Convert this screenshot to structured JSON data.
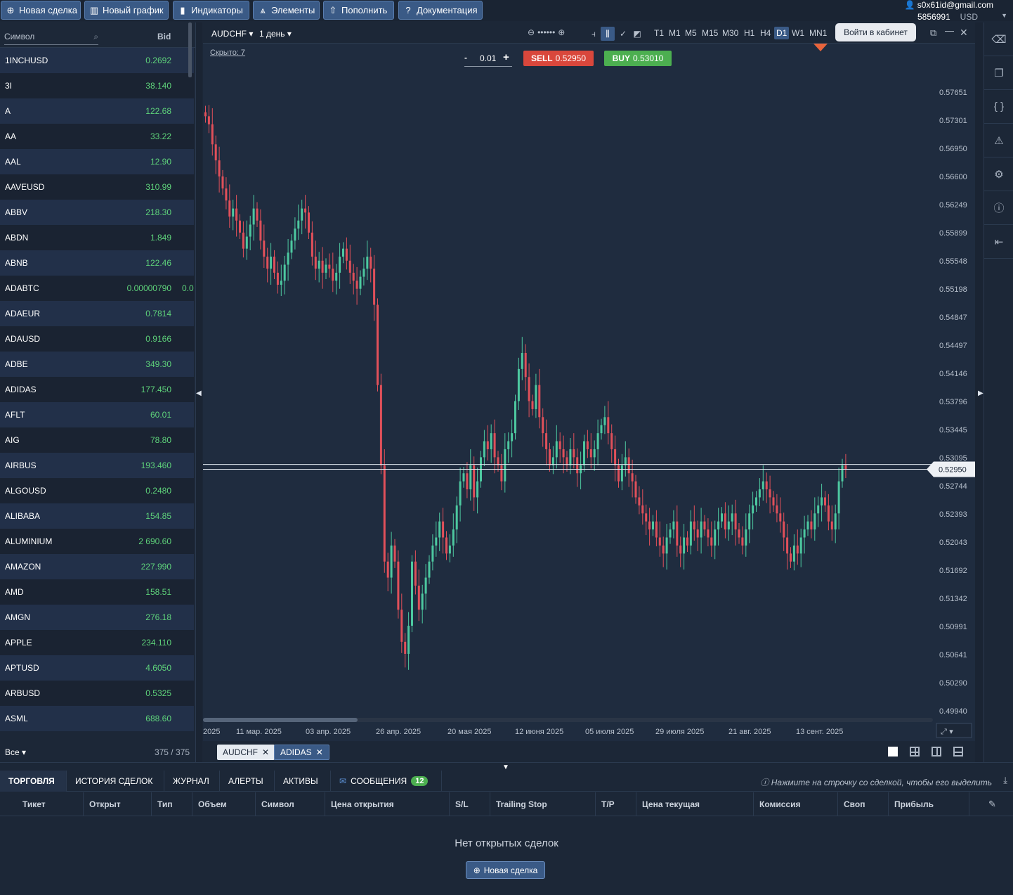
{
  "topbar": {
    "buttons": [
      "Новая сделка",
      "Новый график",
      "Индикаторы",
      "Элементы",
      "Пополнить",
      "Документация"
    ],
    "account_email": "s0x61id@gmail.com",
    "account_number": "5856991",
    "account_currency": "USD"
  },
  "symbols": {
    "search_placeholder": "Символ",
    "bid_header": "Bid",
    "items": [
      {
        "name": "1INCHUSD",
        "bid": "0.2692"
      },
      {
        "name": "3I",
        "bid": "38.140"
      },
      {
        "name": "A",
        "bid": "122.68"
      },
      {
        "name": "AA",
        "bid": "33.22"
      },
      {
        "name": "AAL",
        "bid": "12.90"
      },
      {
        "name": "AAVEUSD",
        "bid": "310.99"
      },
      {
        "name": "ABBV",
        "bid": "218.30"
      },
      {
        "name": "ABDN",
        "bid": "1.849"
      },
      {
        "name": "ABNB",
        "bid": "122.46"
      },
      {
        "name": "ADABTC",
        "bid": "0.00000790",
        "bid_extra": "0.0"
      },
      {
        "name": "ADAEUR",
        "bid": "0.7814"
      },
      {
        "name": "ADAUSD",
        "bid": "0.9166"
      },
      {
        "name": "ADBE",
        "bid": "349.30"
      },
      {
        "name": "ADIDAS",
        "bid": "177.450"
      },
      {
        "name": "AFLT",
        "bid": "60.01"
      },
      {
        "name": "AIG",
        "bid": "78.80"
      },
      {
        "name": "AIRBUS",
        "bid": "193.460"
      },
      {
        "name": "ALGOUSD",
        "bid": "0.2480"
      },
      {
        "name": "ALIBABA",
        "bid": "154.85"
      },
      {
        "name": "ALUMINIUM",
        "bid": "2 690.60"
      },
      {
        "name": "AMAZON",
        "bid": "227.990"
      },
      {
        "name": "AMD",
        "bid": "158.51"
      },
      {
        "name": "AMGN",
        "bid": "276.18"
      },
      {
        "name": "APPLE",
        "bid": "234.110"
      },
      {
        "name": "APTUSD",
        "bid": "4.6050"
      },
      {
        "name": "ARBUSD",
        "bid": "0.5325"
      },
      {
        "name": "ASML",
        "bid": "688.60"
      }
    ],
    "filter": "Все",
    "count": "375 / 375"
  },
  "chart_header": {
    "symbol": "AUDCHF",
    "period": "1 день",
    "timeframes": [
      "T1",
      "M1",
      "M5",
      "M15",
      "M30",
      "H1",
      "H4",
      "D1",
      "W1",
      "MN1"
    ],
    "active_timeframe": "D1",
    "login_tooltip": "Войти в кабинет"
  },
  "trade": {
    "hidden": "Скрыто: 7",
    "lot": "0.01",
    "minus": "-",
    "plus": "+",
    "sell_label": "SELL",
    "sell_price": "0.52950",
    "buy_label": "BUY",
    "buy_price": "0.53010"
  },
  "chart_data": {
    "type": "candlestick",
    "symbol": "AUDCHF",
    "y_ticks": [
      "0.57651",
      "0.57301",
      "0.56950",
      "0.56600",
      "0.56249",
      "0.55899",
      "0.55548",
      "0.55198",
      "0.54847",
      "0.54497",
      "0.54146",
      "0.53796",
      "0.53445",
      "0.53095",
      "0.52744",
      "0.52393",
      "0.52043",
      "0.51692",
      "0.51342",
      "0.50991",
      "0.50641",
      "0.50290",
      "0.49940"
    ],
    "ylim": [
      0.4994,
      0.57651
    ],
    "x_ticks": [
      "2025",
      "11 мар. 2025",
      "03 апр. 2025",
      "26 апр. 2025",
      "20 мая 2025",
      "12 июня 2025",
      "05 июля 2025",
      "29 июля 2025",
      "21 авг. 2025",
      "13 сент. 2025"
    ],
    "current_price": "0.52950",
    "upper_price_label": "0.53010",
    "close_series_approx": [
      0.5735,
      0.5725,
      0.57,
      0.568,
      0.566,
      0.5645,
      0.563,
      0.561,
      0.562,
      0.5605,
      0.559,
      0.557,
      0.5585,
      0.56,
      0.562,
      0.5605,
      0.558,
      0.556,
      0.5545,
      0.556,
      0.554,
      0.5525,
      0.553,
      0.555,
      0.5565,
      0.558,
      0.5595,
      0.5605,
      0.562,
      0.5615,
      0.559,
      0.556,
      0.5545,
      0.5555,
      0.554,
      0.555,
      0.5545,
      0.553,
      0.554,
      0.556,
      0.557,
      0.5555,
      0.554,
      0.553,
      0.552,
      0.5535,
      0.5545,
      0.556,
      0.5545,
      0.55,
      0.54,
      0.53,
      0.518,
      0.516,
      0.52,
      0.518,
      0.512,
      0.508,
      0.5065,
      0.51,
      0.518,
      0.515,
      0.512,
      0.514,
      0.516,
      0.518,
      0.52,
      0.521,
      0.523,
      0.521,
      0.519,
      0.52,
      0.522,
      0.525,
      0.528,
      0.529,
      0.527,
      0.53,
      0.526,
      0.528,
      0.531,
      0.533,
      0.532,
      0.534,
      0.531,
      0.53,
      0.528,
      0.532,
      0.533,
      0.534,
      0.538,
      0.542,
      0.544,
      0.541,
      0.538,
      0.537,
      0.54,
      0.536,
      0.534,
      0.532,
      0.53,
      0.531,
      0.533,
      0.532,
      0.531,
      0.53,
      0.532,
      0.531,
      0.529,
      0.53,
      0.533,
      0.532,
      0.531,
      0.532,
      0.534,
      0.535,
      0.536,
      0.534,
      0.532,
      0.53,
      0.528,
      0.53,
      0.531,
      0.529,
      0.528,
      0.526,
      0.525,
      0.524,
      0.523,
      0.522,
      0.523,
      0.521,
      0.52,
      0.519,
      0.521,
      0.522,
      0.523,
      0.52,
      0.519,
      0.521,
      0.52,
      0.523,
      0.522,
      0.521,
      0.523,
      0.522,
      0.521,
      0.52,
      0.522,
      0.523,
      0.524,
      0.522,
      0.523,
      0.524,
      0.522,
      0.521,
      0.52,
      0.522,
      0.524,
      0.525,
      0.526,
      0.527,
      0.528,
      0.527,
      0.526,
      0.525,
      0.524,
      0.523,
      0.521,
      0.519,
      0.518,
      0.52,
      0.519,
      0.521,
      0.522,
      0.523,
      0.522,
      0.524,
      0.525,
      0.526,
      0.525,
      0.523,
      0.522,
      0.524,
      0.528,
      0.53,
      0.5295
    ]
  },
  "chart_tabs": [
    "AUDCHF",
    "ADIDAS"
  ],
  "bottom": {
    "tabs": [
      "ТОРГОВЛЯ",
      "ИСТОРИЯ СДЕЛОК",
      "ЖУРНАЛ",
      "АЛЕРТЫ",
      "АКТИВЫ",
      "СООБЩЕНИЯ"
    ],
    "messages_count": "12",
    "hint": "Нажмите на строчку со сделкой, чтобы его выделить",
    "columns": [
      "Тикет",
      "Открыт",
      "Тип",
      "Объем",
      "Символ",
      "Цена открытия",
      "S/L",
      "Trailing Stop",
      "T/P",
      "Цена текущая",
      "Комиссия",
      "Своп",
      "Прибыль"
    ],
    "empty_text": "Нет открытых сделок",
    "new_deal": "Новая сделка"
  },
  "colors": {
    "accent": "#3a5a86",
    "sell": "#d9473c",
    "buy": "#4caf50",
    "bid_text": "#5ed27a",
    "candle_up": "#4dc8a0",
    "candle_down": "#e0505a"
  }
}
